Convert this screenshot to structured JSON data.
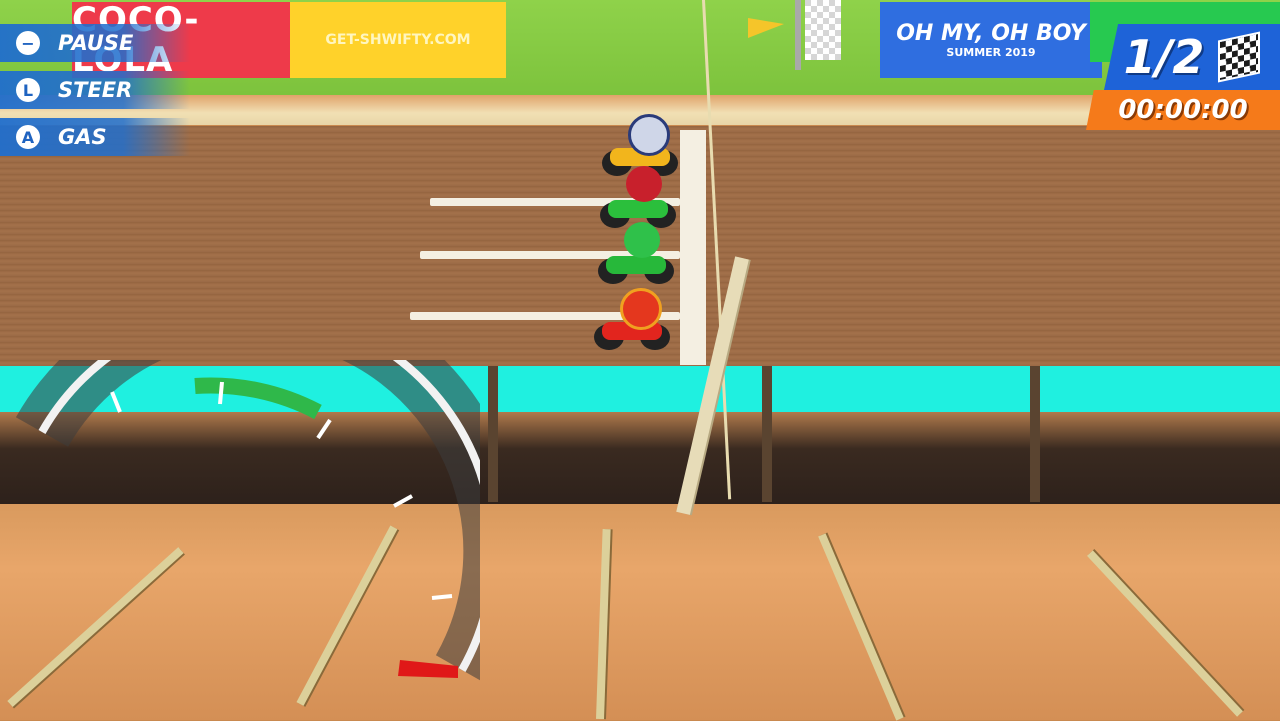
{
  "controls": {
    "pause": {
      "label": "PAUSE",
      "icon": "minus-icon",
      "glyph": "−"
    },
    "steer": {
      "label": "STEER",
      "icon": "left-stick-icon",
      "glyph": "L"
    },
    "gas": {
      "label": "GAS",
      "icon": "a-button-icon",
      "glyph": "A"
    }
  },
  "race": {
    "lap": "1/2",
    "time": "00:00:00"
  },
  "banners": {
    "brand": "COCO-LOLA",
    "site": "GET-SHWIFTY.COM",
    "promo_title": "OH MY, OH BOY",
    "promo_subtitle": "SUMMER 2019"
  },
  "speedometer": {
    "speed_fraction": 0,
    "green_zone": "upper-left"
  },
  "colors": {
    "hud_blue": "#1e63d8",
    "hud_orange": "#f57a1a",
    "track_cyan": "#1ff0e0",
    "speed_green": "#2fb84a",
    "speed_red": "#e01818"
  }
}
